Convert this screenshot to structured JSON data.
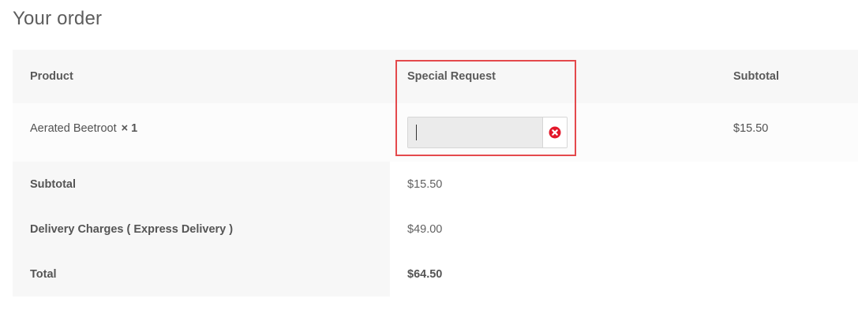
{
  "heading": "Your order",
  "table": {
    "headers": {
      "product": "Product",
      "special_request": "Special Request",
      "subtotal": "Subtotal"
    },
    "item": {
      "name": "Aerated Beetroot",
      "qty": "× 1",
      "special_request_value": "",
      "subtotal": "$15.50"
    },
    "totals": [
      {
        "label": "Subtotal",
        "value": "$15.50"
      },
      {
        "label": "Delivery Charges ( Express Delivery )",
        "value": "$49.00"
      },
      {
        "label": "Total",
        "value": "$64.50"
      }
    ]
  },
  "icons": {
    "clear": "clear-circle-icon"
  },
  "colors": {
    "highlight": "#e4494c",
    "clear_icon": "#e3172a"
  }
}
